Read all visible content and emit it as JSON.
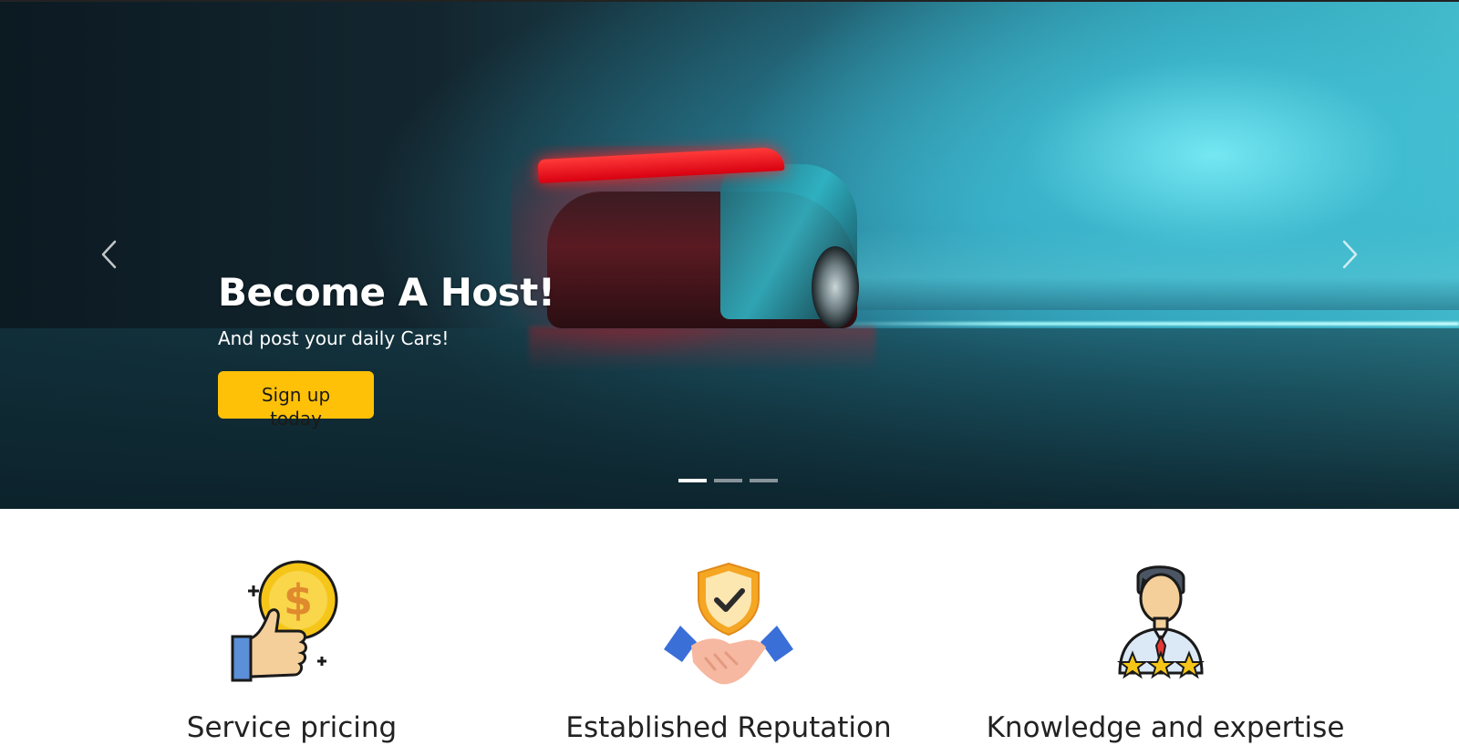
{
  "hero": {
    "title": "Become A Host!",
    "subtitle": "And post your daily Cars!",
    "cta_label": "Sign up today",
    "prev_icon": "chevron-left-icon",
    "next_icon": "chevron-right-icon",
    "slides_count": 3,
    "active_slide": 1
  },
  "features": [
    {
      "label": "Service pricing",
      "icon": "thumbs-up-dollar-icon"
    },
    {
      "label": "Established Reputation",
      "icon": "handshake-shield-icon"
    },
    {
      "label": "Knowledge and expertise",
      "icon": "expert-stars-icon"
    }
  ],
  "colors": {
    "cta_background": "#ffc107",
    "text_dark": "#222222"
  }
}
